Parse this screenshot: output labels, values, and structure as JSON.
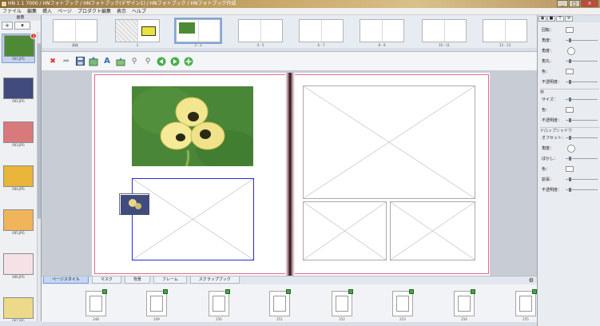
{
  "window": {
    "title": "HN 1 1 7000 / HNフォトブック / HNフォトブック(デザイン1) / HNフォトブック / HNフォトブック作成",
    "minimize": "_",
    "maximize": "□",
    "close": "×"
  },
  "menu": [
    "ファイル",
    "編集",
    "挿入",
    "ページ",
    "プロダクト編集",
    "表示",
    "ヘルプ"
  ],
  "left_panel": {
    "header": "画像",
    "add_button": "+",
    "options_button": "▾",
    "photos": [
      {
        "label": "001.JPG",
        "color": "#4e8a36",
        "badge": "1",
        "selected": true
      },
      {
        "label": "002.JPG",
        "color": "#414b7e"
      },
      {
        "label": "003.JPG",
        "color": "#d87a7c"
      },
      {
        "label": "004.JPG",
        "color": "#e9b53a"
      },
      {
        "label": "005.JPG",
        "color": "#f0b45a"
      },
      {
        "label": "006.JPG",
        "color": "#f6e2e6"
      },
      {
        "label": "007.JPG",
        "color": "#ecd98a"
      }
    ]
  },
  "spreads": [
    {
      "label": "表紙"
    },
    {
      "label": "1"
    },
    {
      "label": "2 - 3",
      "selected": true
    },
    {
      "label": "4 - 5"
    },
    {
      "label": "6 - 7"
    },
    {
      "label": "8 - 9"
    },
    {
      "label": "10 - 11"
    },
    {
      "label": "12 - 13"
    }
  ],
  "toolbar_icons": [
    "delete-icon",
    "redo-icon",
    "save-icon",
    "add-frame-icon",
    "add-text-icon",
    "add-clip-icon",
    "zoom-out-icon",
    "zoom-in-icon",
    "prev-page-icon",
    "next-page-icon",
    "add-page-icon"
  ],
  "bottom_tabs": [
    "ページスタイル",
    "マスク",
    "背景",
    "フレーム",
    "スクラップブック"
  ],
  "layouts": [
    {
      "label": "248"
    },
    {
      "label": "249"
    },
    {
      "label": "250"
    },
    {
      "label": "251"
    },
    {
      "label": "252"
    },
    {
      "label": "253"
    },
    {
      "label": "254"
    },
    {
      "label": "255"
    }
  ],
  "properties": {
    "rows1": [
      "回転：",
      "角度：",
      "角度：",
      "角丸：",
      "色：",
      "不透明度："
    ],
    "section_border": "枠",
    "rows2": [
      "サイズ：",
      "色：",
      "不透明度："
    ],
    "section_shadow": "ドロップシャドウ",
    "rows3": [
      "オフセット：",
      "角度：",
      "ぼかし：",
      "色：",
      "拡張：",
      "不透明度："
    ]
  },
  "colors": {
    "accent": "#7fa6dc",
    "bleed_line": "#e06a8a",
    "selected_frame": "#2b2bd0"
  }
}
